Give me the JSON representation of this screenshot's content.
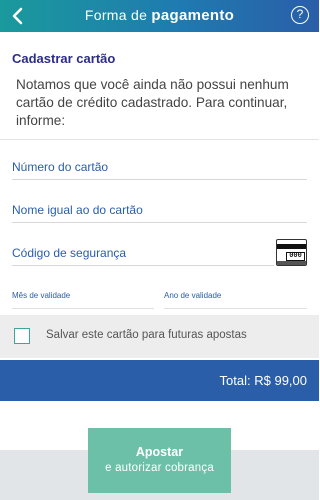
{
  "header": {
    "title_regular": "Forma de ",
    "title_bold": "pagamento",
    "help_label": "?",
    "back_icon": "chevron-left-icon"
  },
  "section": {
    "title": "Cadastrar cartão",
    "intro": "Notamos que você ainda não possui nenhum cartão de crédito cadastrado. Para continuar, informe:"
  },
  "form": {
    "card_number_placeholder": "Número do cartão",
    "card_name_placeholder": "Nome igual ao do cartão",
    "security_code_placeholder": "Código de segurança",
    "security_code_icon": "card-cvv-icon",
    "security_code_icon_text": "000",
    "expiry_month_label": "Mês de validade",
    "expiry_year_label": "Ano de validade"
  },
  "save_card": {
    "label": "Salvar este cartão para futuras apostas",
    "checked": false
  },
  "total": {
    "text": "Total: R$ 99,00"
  },
  "action": {
    "line1": "Apostar",
    "line2": "e autorizar cobrança"
  },
  "colors": {
    "primary_blue": "#2a5ea8",
    "teal": "#1a9a9c",
    "button_green": "#6cc0a8"
  }
}
